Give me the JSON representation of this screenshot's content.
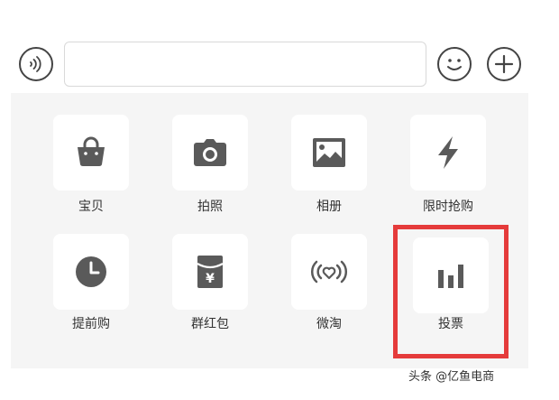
{
  "input_bar": {
    "text_value": "",
    "placeholder": ""
  },
  "panel_items": [
    {
      "label": "宝贝",
      "icon": "shopping-bag-icon"
    },
    {
      "label": "拍照",
      "icon": "camera-icon"
    },
    {
      "label": "相册",
      "icon": "image-icon"
    },
    {
      "label": "限时抢购",
      "icon": "lightning-icon"
    },
    {
      "label": "提前购",
      "icon": "clock-icon"
    },
    {
      "label": "群红包",
      "icon": "red-envelope-icon"
    },
    {
      "label": "微淘",
      "icon": "broadcast-heart-icon"
    },
    {
      "label": "投票",
      "icon": "bar-chart-icon"
    }
  ],
  "watermark": {
    "text": "头条 @亿鱼电商"
  },
  "colors": {
    "icon": "#5a5a5a",
    "panel_background": "#f5f5f5",
    "tile_background": "#ffffff",
    "highlight_border": "#e53b3b"
  }
}
